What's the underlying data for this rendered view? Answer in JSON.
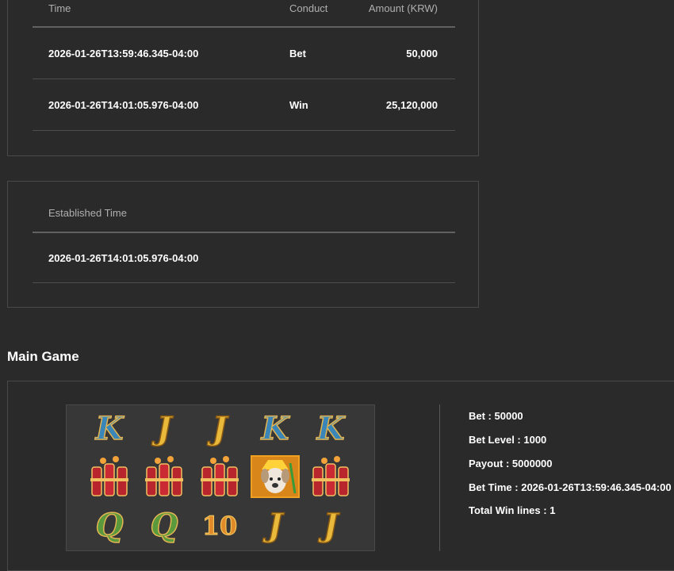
{
  "transactions": {
    "headers": {
      "time": "Time",
      "conduct": "Conduct",
      "amount": "Amount (KRW)"
    },
    "rows": [
      {
        "time": "2026-01-26T13:59:46.345-04:00",
        "conduct": "Bet",
        "amount": "50,000"
      },
      {
        "time": "2026-01-26T14:01:05.976-04:00",
        "conduct": "Win",
        "amount": "25,120,000"
      }
    ]
  },
  "established": {
    "header": "Established Time",
    "value": "2026-01-26T14:01:05.976-04:00"
  },
  "main_game": {
    "title": "Main Game",
    "reels": [
      [
        "K",
        "J",
        "J",
        "K",
        "K"
      ],
      [
        "firecracker",
        "firecracker",
        "firecracker",
        "warrior-dog",
        "firecracker"
      ],
      [
        "Q",
        "Q",
        "10",
        "J",
        "J"
      ]
    ],
    "info": {
      "bet": "Bet : 50000",
      "bet_level": "Bet Level : 1000",
      "payout": "Payout : 5000000",
      "bet_time": "Bet Time : 2026-01-26T13:59:46.345-04:00",
      "total_win_lines": "Total Win lines : 1"
    }
  },
  "colors": {
    "background": "#2b2a2b",
    "border": "#4a494a",
    "header_text": "#b0afb0",
    "text": "#ffffff"
  }
}
